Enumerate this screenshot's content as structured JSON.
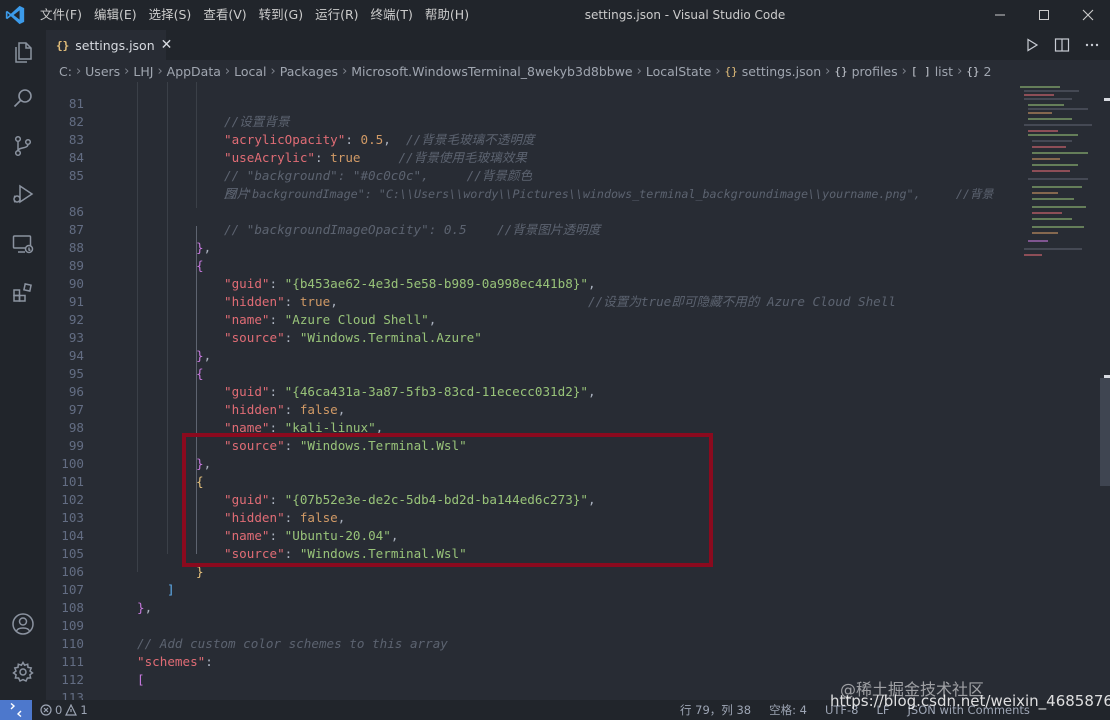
{
  "titlebar": {
    "menu": [
      "文件(F)",
      "编辑(E)",
      "选择(S)",
      "查看(V)",
      "转到(G)",
      "运行(R)",
      "终端(T)",
      "帮助(H)"
    ],
    "title": "settings.json - Visual Studio Code"
  },
  "tab": {
    "label": "settings.json",
    "icon": "{}"
  },
  "breadcrumb": [
    "C:",
    "Users",
    "LHJ",
    "AppData",
    "Local",
    "Packages",
    "Microsoft.WindowsTerminal_8wekyb3d8bbwe",
    "LocalState",
    "settings.json",
    "profiles",
    "list",
    "2"
  ],
  "code": {
    "l81": {
      "num": "81",
      "comment": "//设置背景"
    },
    "l82": {
      "num": "82",
      "key": "\"acrylicOpacity\"",
      "value": "0.5",
      "comment": "//背景毛玻璃不透明度"
    },
    "l83": {
      "num": "83",
      "key": "\"useAcrylic\"",
      "value": "true",
      "comment": "//背景使用毛玻璃效果"
    },
    "l84": {
      "num": "84",
      "comment1": "// \"background\": \"#0c0c0c\",",
      "comment2": "//背景颜色"
    },
    "l85": {
      "num": "85",
      "comment1": "// \"backgroundImage\": \"C:\\\\Users\\\\wordy\\\\Pictures\\\\windows_terminal_backgroundimage\\\\yourname.png\",",
      "comment2": "//背景",
      "cont": "图片"
    },
    "l86": {
      "num": "86",
      "comment1": "// \"backgroundImageOpacity\": 0.5",
      "comment2": "//背景图片透明度"
    },
    "l87": {
      "num": "87"
    },
    "l88": {
      "num": "88"
    },
    "l89": {
      "num": "89",
      "key": "\"guid\"",
      "value": "\"{b453ae62-4e3d-5e58-b989-0a998ec441b8}\""
    },
    "l90": {
      "num": "90",
      "key": "\"hidden\"",
      "value": "true",
      "comment": "//设置为true即可隐藏不用的 Azure Cloud Shell"
    },
    "l91": {
      "num": "91",
      "key": "\"name\"",
      "value": "\"Azure Cloud Shell\""
    },
    "l92": {
      "num": "92",
      "key": "\"source\"",
      "value": "\"Windows.Terminal.Azure\""
    },
    "l93": {
      "num": "93"
    },
    "l94": {
      "num": "94"
    },
    "l95": {
      "num": "95",
      "key": "\"guid\"",
      "value": "\"{46ca431a-3a87-5fb3-83cd-11ececc031d2}\""
    },
    "l96": {
      "num": "96",
      "key": "\"hidden\"",
      "value": "false"
    },
    "l97": {
      "num": "97",
      "key": "\"name\"",
      "value": "\"kali-linux\""
    },
    "l98": {
      "num": "98",
      "key": "\"source\"",
      "value": "\"Windows.Terminal.Wsl\""
    },
    "l99": {
      "num": "99"
    },
    "l100": {
      "num": "100"
    },
    "l101": {
      "num": "101",
      "key": "\"guid\"",
      "value": "\"{07b52e3e-de2c-5db4-bd2d-ba144ed6c273}\""
    },
    "l102": {
      "num": "102",
      "key": "\"hidden\"",
      "value": "false"
    },
    "l103": {
      "num": "103",
      "key": "\"name\"",
      "value": "\"Ubuntu-20.04\""
    },
    "l104": {
      "num": "104",
      "key": "\"source\"",
      "value": "\"Windows.Terminal.Wsl\""
    },
    "l105": {
      "num": "105"
    },
    "l106": {
      "num": "106"
    },
    "l107": {
      "num": "107"
    },
    "l108": {
      "num": "108"
    },
    "l109": {
      "num": "109",
      "comment": "// Add custom color schemes to this array"
    },
    "l110": {
      "num": "110",
      "key": "\"schemes\""
    },
    "l111": {
      "num": "111"
    },
    "l112": {
      "num": "112"
    },
    "l113": {
      "num": "113"
    },
    "l114": {
      "num": "114"
    }
  },
  "statusbar": {
    "errors": "0",
    "warnings": "1",
    "position": "行 79，列 38",
    "indent": "空格: 4",
    "encoding": "UTF-8",
    "eol": "LF",
    "language": "JSON with Comments"
  },
  "watermark": {
    "text": "@稀土掘金技术社区",
    "url": "https://blog.csdn.net/weixin_46858768"
  },
  "colors": {
    "accent": "#4d78cc",
    "highlight_box": "#8b0a1e",
    "background": "#282c34",
    "chrome": "#21252b"
  }
}
